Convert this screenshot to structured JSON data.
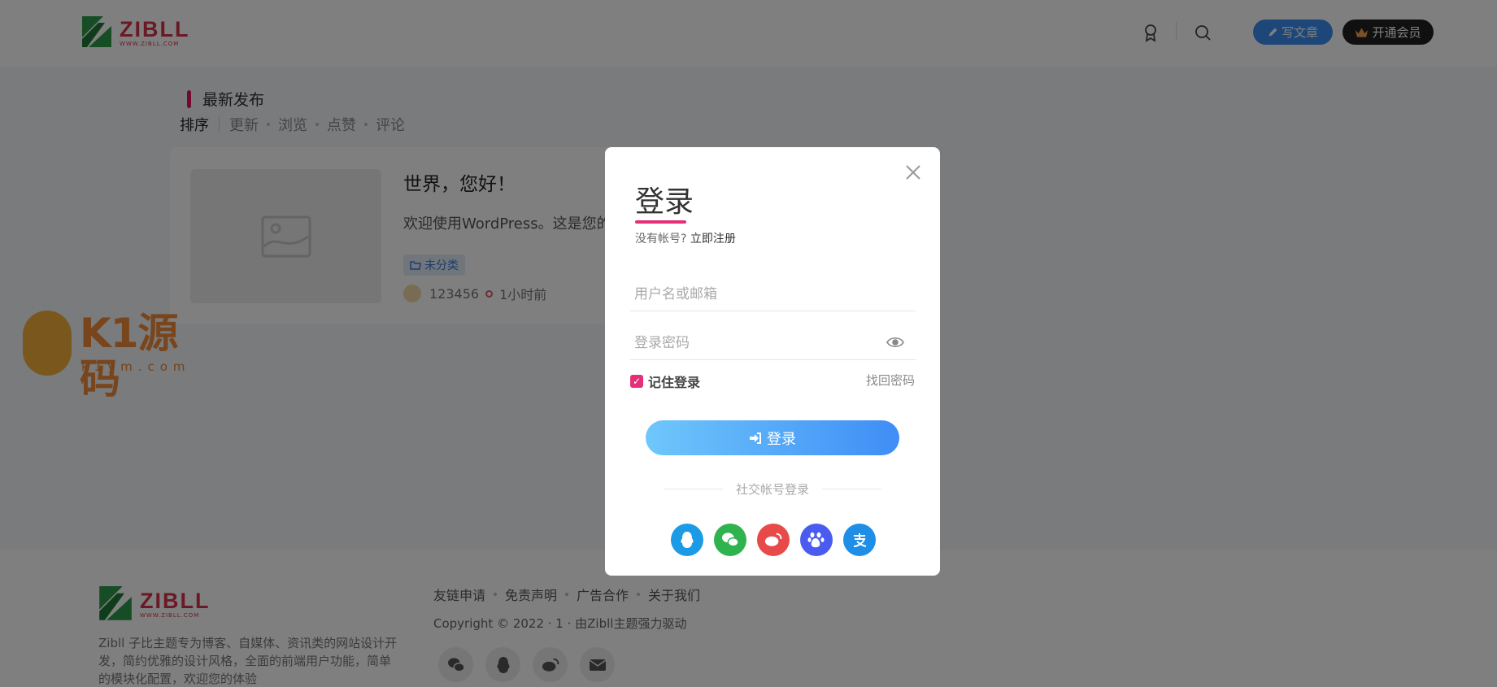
{
  "header": {
    "logo_word": "ZIBLL",
    "logo_sub": "WWW.ZIBLL.COM",
    "write_label": "写文章",
    "vip_label": "开通会员"
  },
  "section": {
    "title": "最新发布",
    "tabs": [
      "排序",
      "更新",
      "浏览",
      "点赞",
      "评论"
    ]
  },
  "post": {
    "title": "世界，您好！",
    "excerpt": "欢迎使用WordPress。这是您的第",
    "tag": "未分类",
    "author": "123456",
    "time": "1小时前"
  },
  "watermark": {
    "text": "K1源码",
    "sub": "k1ym.com"
  },
  "footer": {
    "logo_word": "ZIBLL",
    "logo_sub": "WWW.ZIBLL.COM",
    "description": "Zibll 子比主题专为博客、自媒体、资讯类的网站设计开发，简约优雅的设计风格，全面的前端用户功能，简单的模块化配置，欢迎您的体验",
    "links": [
      "友链申请",
      "免责声明",
      "广告合作",
      "关于我们"
    ],
    "copyright": "Copyright © 2022 · 1 · 由Zibll主题强力驱动"
  },
  "modal": {
    "title": "登录",
    "no_account": "没有帐号?",
    "register": "立即注册",
    "username_placeholder": "用户名或邮箱",
    "password_placeholder": "登录密码",
    "remember_label": "记住登录",
    "forgot_label": "找回密码",
    "login_label": "登录",
    "social_title": "社交帐号登录"
  },
  "colors": {
    "accent_pink": "#e52f78",
    "brand_blue": "#3c8ef2",
    "qq": "#1b9ae6",
    "wechat": "#2fb34f",
    "weibo": "#e84a4a",
    "baidu": "#4a5cf0",
    "alipay": "#1f8ee6"
  }
}
